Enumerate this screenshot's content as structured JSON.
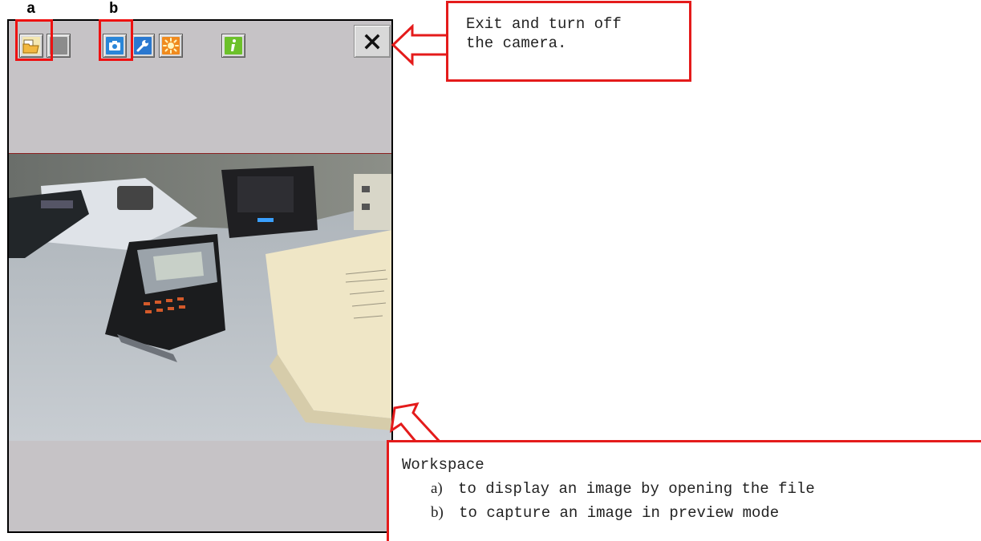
{
  "labels": {
    "a": "a",
    "b": "b"
  },
  "toolbar": {
    "buttons": [
      {
        "icon": "open-file-icon"
      },
      {
        "icon": "blank-icon"
      },
      {
        "icon": "camera-icon"
      },
      {
        "icon": "wrench-icon"
      },
      {
        "icon": "brightness-icon"
      },
      {
        "icon": "info-icon"
      }
    ],
    "close_icon": "close-icon"
  },
  "callouts": {
    "exit": {
      "line1": "Exit and turn off",
      "line2": "the camera."
    },
    "workspace": {
      "title": "Workspace",
      "items": [
        {
          "marker": "a)",
          "text": "to display an image by opening the file"
        },
        {
          "marker": "b)",
          "text": "to capture an image in preview mode"
        }
      ]
    }
  },
  "colors": {
    "highlight": "#ee1111",
    "device_bg": "#c6c3c6"
  }
}
